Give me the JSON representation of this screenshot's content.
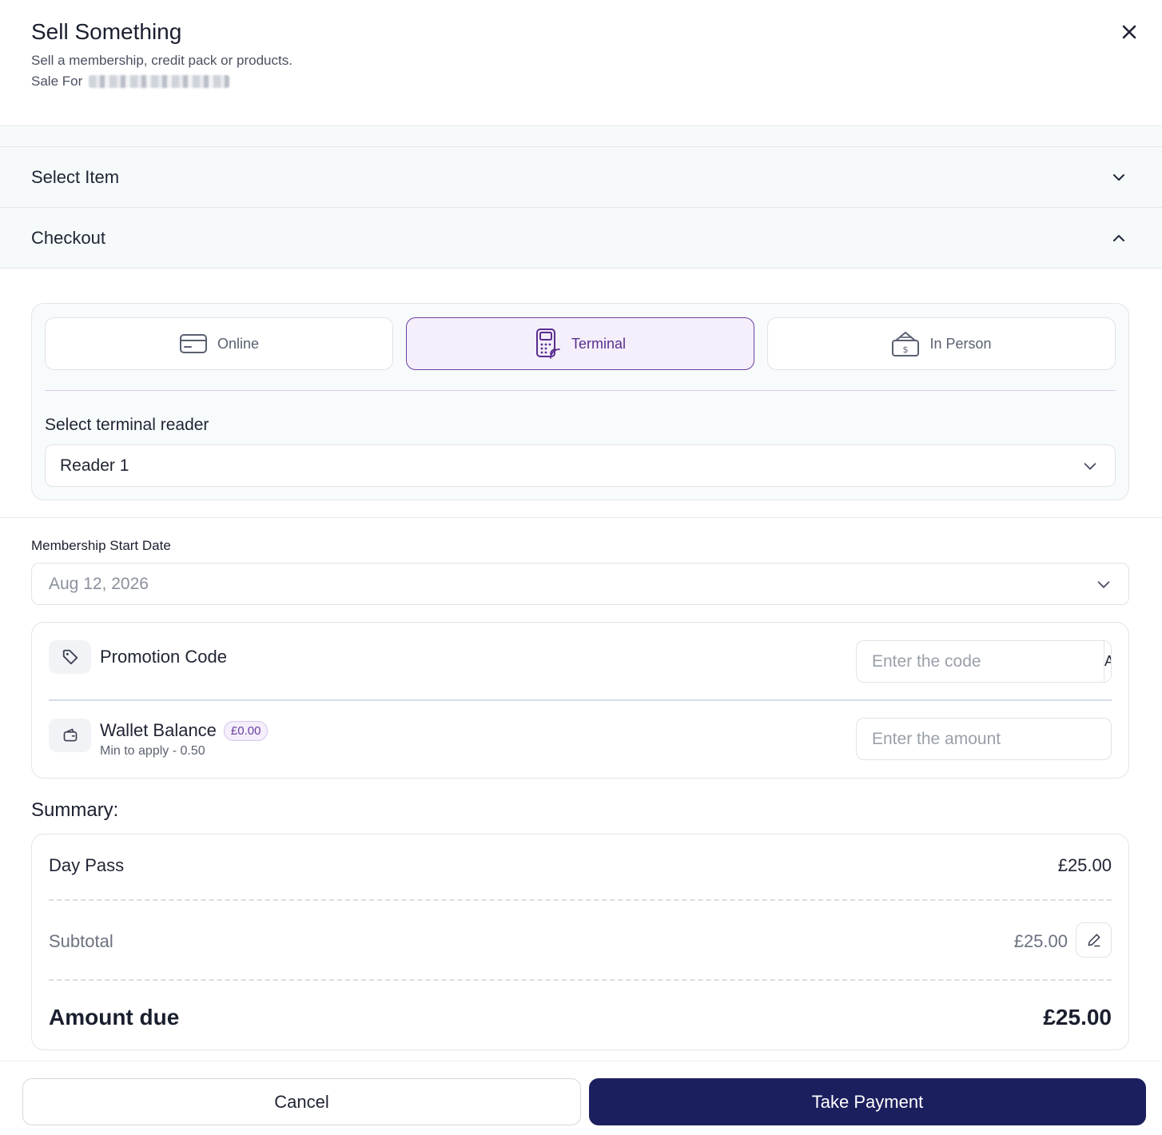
{
  "header": {
    "title": "Sell Something",
    "subtitle": "Sell a membership, credit pack or products.",
    "sale_for_label": "Sale For"
  },
  "sections": {
    "select_item": "Select Item",
    "checkout": "Checkout"
  },
  "payment_methods": {
    "online": "Online",
    "terminal": "Terminal",
    "in_person": "In Person",
    "selected": "terminal"
  },
  "terminal": {
    "label": "Select terminal reader",
    "value": "Reader 1"
  },
  "membership": {
    "label": "Membership Start Date",
    "value": "Aug 12, 2026"
  },
  "promo": {
    "label": "Promotion Code",
    "placeholder": "Enter the code",
    "apply_label": "Apply"
  },
  "wallet": {
    "label": "Wallet Balance",
    "balance": "£0.00",
    "hint": "Min to apply - 0.50",
    "placeholder": "Enter the amount"
  },
  "summary": {
    "title": "Summary:",
    "item_name": "Day Pass",
    "item_price": "£25.00",
    "subtotal_label": "Subtotal",
    "subtotal_value": "£25.00",
    "amount_due_label": "Amount due",
    "amount_due_value": "£25.00"
  },
  "footer": {
    "cancel_label": "Cancel",
    "pay_label": "Take Payment"
  },
  "colors": {
    "accent": "#6b3fa0",
    "primary_button": "#1c1f5e",
    "section_bg": "#f6fafb"
  },
  "icons": {
    "close": "close-icon",
    "chevron_down": "chevron-down-icon",
    "chevron_up": "chevron-up-icon",
    "card": "credit-card-icon",
    "terminal": "card-terminal-icon",
    "cash": "cash-icon",
    "tag": "tag-icon",
    "wallet": "wallet-icon",
    "edit": "pencil-icon"
  }
}
